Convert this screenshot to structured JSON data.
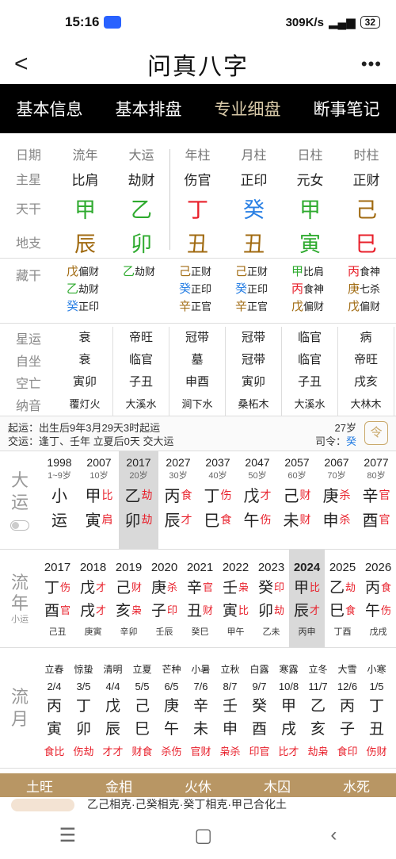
{
  "status": {
    "time": "15:16",
    "speed": "309K/s",
    "battery": "32"
  },
  "nav": {
    "title": "问真八字",
    "more": "•••",
    "back": "<"
  },
  "tabs": [
    "基本信息",
    "基本排盘",
    "专业细盘",
    "断事笔记"
  ],
  "pillars": {
    "labels": [
      "日期",
      "主星",
      "天干",
      "地支"
    ],
    "headers": [
      "流年",
      "大运",
      "年柱",
      "月柱",
      "日柱",
      "时柱"
    ],
    "stars": [
      "比肩",
      "劫财",
      "伤官",
      "正印",
      "元女",
      "正财"
    ],
    "stems": [
      {
        "t": "甲",
        "c": "green"
      },
      {
        "t": "乙",
        "c": "green"
      },
      {
        "t": "丁",
        "c": "red"
      },
      {
        "t": "癸",
        "c": "blue"
      },
      {
        "t": "甲",
        "c": "green"
      },
      {
        "t": "己",
        "c": "brown"
      }
    ],
    "branches": [
      {
        "t": "辰",
        "c": "brown"
      },
      {
        "t": "卯",
        "c": "green"
      },
      {
        "t": "丑",
        "c": "brown"
      },
      {
        "t": "丑",
        "c": "brown"
      },
      {
        "t": "寅",
        "c": "green"
      },
      {
        "t": "巳",
        "c": "red"
      }
    ]
  },
  "canggan": {
    "label": "藏干",
    "cols": [
      [
        {
          "g": "戊",
          "c": "brown",
          "s": "偏财"
        },
        {
          "g": "乙",
          "c": "green",
          "s": "劫财"
        },
        {
          "g": "癸",
          "c": "blue",
          "s": "正印"
        }
      ],
      [
        {
          "g": "乙",
          "c": "green",
          "s": "劫财"
        }
      ],
      [
        {
          "g": "己",
          "c": "brown",
          "s": "正财"
        },
        {
          "g": "癸",
          "c": "blue",
          "s": "正印"
        },
        {
          "g": "辛",
          "c": "brown",
          "s": "正官"
        }
      ],
      [
        {
          "g": "己",
          "c": "brown",
          "s": "正财"
        },
        {
          "g": "癸",
          "c": "blue",
          "s": "正印"
        },
        {
          "g": "辛",
          "c": "brown",
          "s": "正官"
        }
      ],
      [
        {
          "g": "甲",
          "c": "green",
          "s": "比肩"
        },
        {
          "g": "丙",
          "c": "red",
          "s": "食神"
        },
        {
          "g": "戊",
          "c": "brown",
          "s": "偏财"
        }
      ],
      [
        {
          "g": "丙",
          "c": "red",
          "s": "食神"
        },
        {
          "g": "庚",
          "c": "brown",
          "s": "七杀"
        },
        {
          "g": "戊",
          "c": "brown",
          "s": "偏财"
        }
      ]
    ]
  },
  "star_rows": [
    {
      "label": "星运",
      "vals": [
        "衰",
        "帝旺",
        "冠带",
        "冠带",
        "临官",
        "病"
      ]
    },
    {
      "label": "自坐",
      "vals": [
        "衰",
        "临官",
        "墓",
        "冠带",
        "临官",
        "帝旺"
      ]
    },
    {
      "label": "空亡",
      "vals": [
        "寅卯",
        "子丑",
        "申酉",
        "寅卯",
        "子丑",
        "戌亥"
      ]
    },
    {
      "label": "纳音",
      "vals": [
        "覆灯火",
        "大溪水",
        "涧下水",
        "桑柘木",
        "大溪水",
        "大林木"
      ]
    }
  ],
  "qiyun": {
    "line1": "起运：出生后9年3月29天3时起运",
    "line2": "交运：逢丁、壬年 立夏后0天 交大运",
    "age": "27岁",
    "siling_label": "司令：",
    "siling": "癸",
    "icon": "令"
  },
  "dayun": {
    "label": "大运",
    "items": [
      {
        "yr": "1998",
        "age": "1~9岁",
        "g1": "小",
        "g2": "运",
        "s1": "",
        "s2": "",
        "small": true
      },
      {
        "yr": "2007",
        "age": "10岁",
        "g1": "甲",
        "g2": "寅",
        "s1": "比",
        "s2": "肩"
      },
      {
        "yr": "2017",
        "age": "20岁",
        "g1": "乙",
        "g2": "卯",
        "s1": "劫",
        "s2": "劫",
        "sel": true
      },
      {
        "yr": "2027",
        "age": "30岁",
        "g1": "丙",
        "g2": "辰",
        "s1": "食",
        "s2": "才"
      },
      {
        "yr": "2037",
        "age": "40岁",
        "g1": "丁",
        "g2": "巳",
        "s1": "伤",
        "s2": "食"
      },
      {
        "yr": "2047",
        "age": "50岁",
        "g1": "戊",
        "g2": "午",
        "s1": "才",
        "s2": "伤"
      },
      {
        "yr": "2057",
        "age": "60岁",
        "g1": "己",
        "g2": "未",
        "s1": "财",
        "s2": "财"
      },
      {
        "yr": "2067",
        "age": "70岁",
        "g1": "庚",
        "g2": "申",
        "s1": "杀",
        "s2": "杀"
      },
      {
        "yr": "2077",
        "age": "80岁",
        "g1": "辛",
        "g2": "酉",
        "s1": "官",
        "s2": "官"
      }
    ]
  },
  "liunian": {
    "label": "流年",
    "sub": "小运",
    "items": [
      {
        "yr": "2017",
        "g1": "丁",
        "g2": "酉",
        "s1": "伤",
        "s2": "官",
        "ny": "己丑"
      },
      {
        "yr": "2018",
        "g1": "戊",
        "g2": "戌",
        "s1": "才",
        "s2": "才",
        "ny": "庚寅"
      },
      {
        "yr": "2019",
        "g1": "己",
        "g2": "亥",
        "s1": "财",
        "s2": "枭",
        "ny": "辛卯"
      },
      {
        "yr": "2020",
        "g1": "庚",
        "g2": "子",
        "s1": "杀",
        "s2": "印",
        "ny": "壬辰"
      },
      {
        "yr": "2021",
        "g1": "辛",
        "g2": "丑",
        "s1": "官",
        "s2": "财",
        "ny": "癸巳"
      },
      {
        "yr": "2022",
        "g1": "壬",
        "g2": "寅",
        "s1": "枭",
        "s2": "比",
        "ny": "甲午"
      },
      {
        "yr": "2023",
        "g1": "癸",
        "g2": "卯",
        "s1": "印",
        "s2": "劫",
        "ny": "乙未"
      },
      {
        "yr": "2024",
        "g1": "甲",
        "g2": "辰",
        "s1": "比",
        "s2": "才",
        "ny": "丙申",
        "sel": true
      },
      {
        "yr": "2025",
        "g1": "乙",
        "g2": "巳",
        "s1": "劫",
        "s2": "食",
        "ny": "丁酉"
      },
      {
        "yr": "2026",
        "g1": "丙",
        "g2": "午",
        "s1": "食",
        "s2": "伤",
        "ny": "戊戌"
      }
    ]
  },
  "liuyue": {
    "label": "流月",
    "items": [
      {
        "jq": "立春",
        "dt": "2/4",
        "g1": "丙",
        "g2": "寅",
        "ss": "食比"
      },
      {
        "jq": "惊蛰",
        "dt": "3/5",
        "g1": "丁",
        "g2": "卯",
        "ss": "伤劫"
      },
      {
        "jq": "清明",
        "dt": "4/4",
        "g1": "戊",
        "g2": "辰",
        "ss": "才才"
      },
      {
        "jq": "立夏",
        "dt": "5/5",
        "g1": "己",
        "g2": "巳",
        "ss": "财食"
      },
      {
        "jq": "芒种",
        "dt": "6/5",
        "g1": "庚",
        "g2": "午",
        "ss": "杀伤"
      },
      {
        "jq": "小暑",
        "dt": "7/6",
        "g1": "辛",
        "g2": "未",
        "ss": "官财"
      },
      {
        "jq": "立秋",
        "dt": "8/7",
        "g1": "壬",
        "g2": "申",
        "ss": "枭杀"
      },
      {
        "jq": "白露",
        "dt": "9/7",
        "g1": "癸",
        "g2": "酉",
        "ss": "印官"
      },
      {
        "jq": "寒露",
        "dt": "10/8",
        "g1": "甲",
        "g2": "戌",
        "ss": "比才"
      },
      {
        "jq": "立冬",
        "dt": "11/7",
        "g1": "乙",
        "g2": "亥",
        "ss": "劫枭"
      },
      {
        "jq": "大雪",
        "dt": "12/6",
        "g1": "丙",
        "g2": "子",
        "ss": "食印"
      },
      {
        "jq": "小寒",
        "dt": "1/5",
        "g1": "丁",
        "g2": "丑",
        "ss": "伤财"
      }
    ]
  },
  "wuxing": [
    "土旺",
    "金相",
    "火休",
    "木囚",
    "水死"
  ],
  "bottom": "乙己相克·己癸相克·癸丁相克·甲己合化土"
}
